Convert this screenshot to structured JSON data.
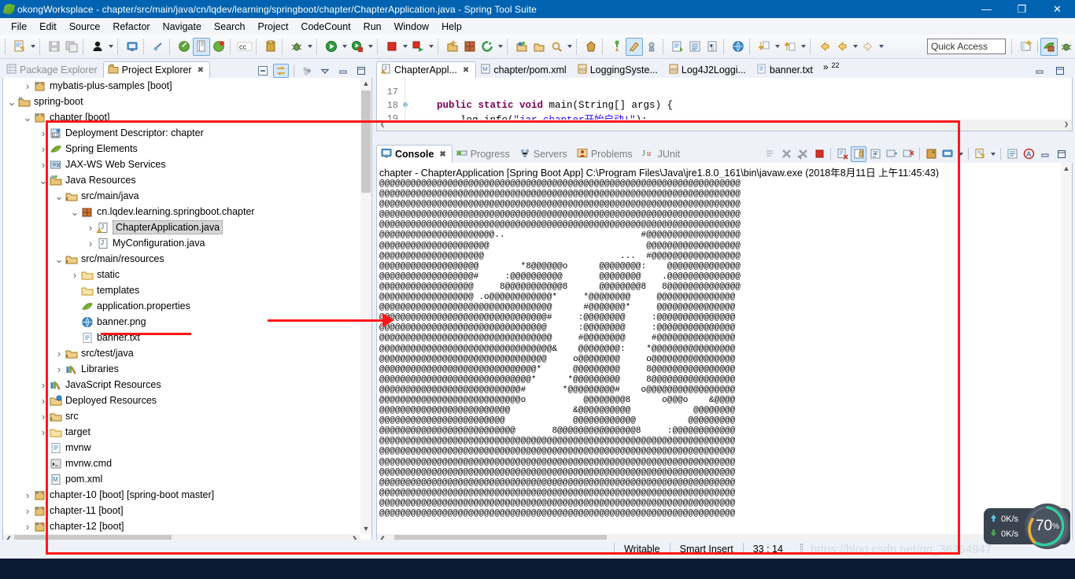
{
  "window": {
    "title": "okongWorksplace - chapter/src/main/java/cn/lqdev/learning/springboot/chapter/ChapterApplication.java - Spring Tool Suite",
    "app_icon": "sts-leaf-icon",
    "minimize": "—",
    "restore": "❐",
    "close": "✕"
  },
  "menu": {
    "items": [
      {
        "label": "File",
        "mnemonic": "F"
      },
      {
        "label": "Edit",
        "mnemonic": "E"
      },
      {
        "label": "Source",
        "mnemonic": "S"
      },
      {
        "label": "Refactor",
        "mnemonic": "t"
      },
      {
        "label": "Navigate",
        "mnemonic": "N"
      },
      {
        "label": "Search",
        "mnemonic": "a"
      },
      {
        "label": "Project",
        "mnemonic": "P"
      },
      {
        "label": "CodeCount",
        "mnemonic": "C"
      },
      {
        "label": "Run",
        "mnemonic": "R"
      },
      {
        "label": "Window",
        "mnemonic": "W"
      },
      {
        "label": "Help",
        "mnemonic": "H"
      }
    ]
  },
  "toolbar": {
    "quick_access_placeholder": "Quick Access",
    "buttons": [
      "new-wizard-icon",
      "save-icon",
      "save-all-icon",
      "user-icon",
      "console-view-icon",
      "disable-breakpoint-icon",
      "spring-boot-dashboard-icon",
      "boot-wizard-icon",
      "spring-icon",
      "codecount-icon",
      "copy-icon",
      "debug-icon",
      "run-icon",
      "run-boot-icon",
      "terminate-icon",
      "relaunch-icon",
      "new-java-project-icon",
      "new-package-icon",
      "refresh-icon",
      "open-type-icon",
      "open-resource-icon",
      "search-icon",
      "bucket-icon",
      "pin-icon",
      "toggle-mark-occurrences-icon",
      "annotation-icon",
      "open-task-icon",
      "outline-icon",
      "paragraph-icon",
      "web-browser-icon",
      "next-annotation-icon",
      "prev-annotation-icon",
      "back-icon",
      "forward-back-icon",
      "forward-icon"
    ],
    "right_buttons": [
      "open-perspective-icon",
      "spring-perspective-icon",
      "debug-perspective-icon"
    ]
  },
  "explorer": {
    "tabs": [
      {
        "label": "Package Explorer",
        "icon": "package-explorer-icon",
        "active": false,
        "closeable": false
      },
      {
        "label": "Project Explorer",
        "icon": "project-explorer-icon",
        "active": true,
        "closeable": true
      }
    ],
    "view_tools": [
      "collapse-all-icon",
      "link-with-editor-icon",
      "view-menu-icon",
      "minimize-icon",
      "maximize-icon"
    ],
    "tree": [
      {
        "indent": 1,
        "twisty": "collapsed",
        "icon": "maven-project-icon",
        "label": "mybatis-plus-samples",
        "suffix": " [boot]"
      },
      {
        "indent": 0,
        "twisty": "expanded",
        "icon": "project-folder-icon",
        "label": "spring-boot",
        "suffix": ""
      },
      {
        "indent": 1,
        "twisty": "expanded",
        "icon": "maven-project-icon",
        "label": "chapter",
        "suffix": " [boot]"
      },
      {
        "indent": 2,
        "twisty": "collapsed",
        "icon": "deployment-descriptor-icon",
        "label": "Deployment Descriptor: chapter",
        "suffix": ""
      },
      {
        "indent": 2,
        "twisty": "collapsed",
        "icon": "spring-leaf-icon",
        "label": "Spring Elements",
        "suffix": ""
      },
      {
        "indent": 2,
        "twisty": "collapsed",
        "icon": "jaxws-icon",
        "label": "JAX-WS Web Services",
        "suffix": ""
      },
      {
        "indent": 2,
        "twisty": "expanded",
        "icon": "java-resources-icon",
        "label": "Java Resources",
        "suffix": ""
      },
      {
        "indent": 3,
        "twisty": "expanded",
        "icon": "source-folder-icon",
        "label": "src/main/java",
        "suffix": ""
      },
      {
        "indent": 4,
        "twisty": "expanded",
        "icon": "package-icon",
        "label": "cn.lqdev.learning.springboot.chapter",
        "suffix": ""
      },
      {
        "indent": 5,
        "twisty": "collapsed",
        "icon": "java-class-warning-icon",
        "label": "ChapterApplication.java",
        "suffix": "",
        "selected": true
      },
      {
        "indent": 5,
        "twisty": "collapsed",
        "icon": "java-class-icon",
        "label": "MyConfiguration.java",
        "suffix": ""
      },
      {
        "indent": 3,
        "twisty": "expanded",
        "icon": "source-folder-icon",
        "label": "src/main/resources",
        "suffix": ""
      },
      {
        "indent": 4,
        "twisty": "collapsed",
        "icon": "folder-icon",
        "label": "static",
        "suffix": ""
      },
      {
        "indent": 4,
        "twisty": "none",
        "icon": "folder-icon",
        "label": "templates",
        "suffix": ""
      },
      {
        "indent": 4,
        "twisty": "none",
        "icon": "spring-leaf-icon",
        "label": "application.properties",
        "suffix": ""
      },
      {
        "indent": 4,
        "twisty": "none",
        "icon": "image-file-icon",
        "label": "banner.png",
        "suffix": "",
        "underlined": true
      },
      {
        "indent": 4,
        "twisty": "none",
        "icon": "text-file-icon",
        "label": "banner.txt",
        "suffix": ""
      },
      {
        "indent": 3,
        "twisty": "collapsed",
        "icon": "source-folder-icon",
        "label": "src/test/java",
        "suffix": ""
      },
      {
        "indent": 3,
        "twisty": "collapsed",
        "icon": "library-icon",
        "label": "Libraries",
        "suffix": ""
      },
      {
        "indent": 2,
        "twisty": "collapsed",
        "icon": "library-icon",
        "label": "JavaScript Resources",
        "suffix": ""
      },
      {
        "indent": 2,
        "twisty": "collapsed",
        "icon": "deployed-resources-icon",
        "label": "Deployed Resources",
        "suffix": ""
      },
      {
        "indent": 2,
        "twisty": "collapsed",
        "icon": "source-folder-icon",
        "label": "src",
        "suffix": ""
      },
      {
        "indent": 2,
        "twisty": "collapsed",
        "icon": "folder-icon",
        "label": "target",
        "suffix": ""
      },
      {
        "indent": 2,
        "twisty": "none",
        "icon": "text-file-icon",
        "label": "mvnw",
        "suffix": ""
      },
      {
        "indent": 2,
        "twisty": "none",
        "icon": "cmd-file-icon",
        "label": "mvnw.cmd",
        "suffix": ""
      },
      {
        "indent": 2,
        "twisty": "none",
        "icon": "maven-pom-icon",
        "label": "pom.xml",
        "suffix": ""
      },
      {
        "indent": 1,
        "twisty": "collapsed",
        "icon": "maven-project-icon",
        "label": "chapter-10",
        "suffix": " [boot] [spring-boot master]"
      },
      {
        "indent": 1,
        "twisty": "collapsed",
        "icon": "maven-project-icon",
        "label": "chapter-11",
        "suffix": " [boot]"
      },
      {
        "indent": 1,
        "twisty": "collapsed",
        "icon": "maven-project-icon",
        "label": "chapter-12",
        "suffix": " [boot]"
      }
    ]
  },
  "editor": {
    "tabs": [
      {
        "label": "ChapterAppl...",
        "icon": "java-class-warning-icon",
        "active": true,
        "closeable": true
      },
      {
        "label": "chapter/pom.xml",
        "icon": "maven-pom-icon",
        "active": false,
        "closeable": false
      },
      {
        "label": "LoggingSyste...",
        "icon": "properties-file-icon",
        "active": false,
        "closeable": false
      },
      {
        "label": "Log4J2Loggi...",
        "icon": "properties-file-icon",
        "active": false,
        "closeable": false
      },
      {
        "label": "banner.txt",
        "icon": "text-file-icon",
        "active": false,
        "closeable": false
      }
    ],
    "overflow_count": "22",
    "overflow_chevron": "»",
    "lines": [
      {
        "num": "17",
        "fold": "",
        "text": ""
      },
      {
        "num": "18",
        "fold": "⊖",
        "text": "    public static void main(String[] args) {"
      },
      {
        "num": "19",
        "fold": "",
        "text": "        log.info(\"jar chapter开始启动!\");"
      }
    ]
  },
  "console": {
    "tabs": [
      {
        "label": "Console",
        "icon": "console-icon",
        "active": true,
        "closeable": true
      },
      {
        "label": "Progress",
        "icon": "progress-icon",
        "active": false,
        "closeable": false
      },
      {
        "label": "Servers",
        "icon": "servers-icon",
        "active": false,
        "closeable": false
      },
      {
        "label": "Problems",
        "icon": "problems-icon",
        "active": false,
        "closeable": false
      },
      {
        "label": "JUnit",
        "icon": "junit-icon",
        "active": false,
        "closeable": false
      }
    ],
    "tools": [
      "remove-all-terminated-icon",
      "terminate-icon",
      "remove-launch-icon",
      "stop-icon",
      "clear-console-icon",
      "scroll-lock-icon",
      "word-wrap-icon",
      "show-console-on-output-icon",
      "show-console-on-error-icon",
      "pin-console-icon",
      "display-selected-console-icon",
      "open-console-icon",
      "outline-icon",
      "error-log-icon",
      "minimize-icon",
      "maximize-icon"
    ],
    "header": "chapter - ChapterApplication [Spring Boot App] C:\\Program Files\\Java\\jre1.8.0_161\\bin\\javaw.exe (2018年8月11日 上午11:45:43)",
    "ascii_lines": [
      "@@@@@@@@@@@@@@@@@@@@@@@@@@@@@@@@@@@@@@@@@@@@@@@@@@@@@@@@@@@@@@@@@@@@@",
      "@@@@@@@@@@@@@@@@@@@@@@@@@@@@@@@@@@@@@@@@@@@@@@@@@@@@@@@@@@@@@@@@@@@@@",
      "@@@@@@@@@@@@@@@@@@@@@@@@@@@@@@@@@@@@@@@@@@@@@@@@@@@@@@@@@@@@@@@@@@@@@",
      "@@@@@@@@@@@@@@@@@@@@@@@@@@@@@@@@@@@@@@@@@@@@@@@@@@@@@@@@@@@@@@@@@@@@@",
      "@@@@@@@@@@@@@@@@@@@@@@@@@@@@@@@@@@@@@@@@@@@@@@@@@@@@@@@@@@@@@@@@@@@@@",
      "@@@@@@@@@@@@@@@@@@@@@@..                          #@@@@@@@@@@@@@@@@@@",
      "@@@@@@@@@@@@@@@@@@@@@                              @@@@@@@@@@@@@@@@@@",
      "@@@@@@@@@@@@@@@@@@@@                          ...  #@@@@@@@@@@@@@@@@@",
      "@@@@@@@@@@@@@@@@@@@        *8@@@@@@o      @@@@@@@@:    @@@@@@@@@@@@@@",
      "@@@@@@@@@@@@@@@@@@#     :@@@@@@@@@@       @@@@@@@@    .@@@@@@@@@@@@@@",
      "@@@@@@@@@@@@@@@@@@     8@@@@@@@@@@@8      @@@@@@@@8   8@@@@@@@@@@@@@@",
      "@@@@@@@@@@@@@@@@@@ .o@@@@@@@@@@@@*     *@@@@@@@@     @@@@@@@@@@@@@@@",
      "@@@@@@@@@@@@@@@@@@@@@@@@@@@@@@@@@      #@@@@@@@*     @@@@@@@@@@@@@@@",
      "@@@@@@@@@@@@@@@@@@@@@@@@@@@@@@@@#     :@@@@@@@@     :@@@@@@@@@@@@@@@",
      "@@@@@@@@@@@@@@@@@@@@@@@@@@@@@@@@      :@@@@@@@@     :@@@@@@@@@@@@@@@",
      "@@@@@@@@@@@@@@@@@@@@@@@@@@@@@@@@@     #@@@@@@@@     #@@@@@@@@@@@@@@@",
      "@@@@@@@@@@@@@@@@@@@@@@@@@@@@@@@@@&    @@@@@@@@:    *@@@@@@@@@@@@@@@@",
      "@@@@@@@@@@@@@@@@@@@@@@@@@@@@@@@@     o@@@@@@@@     o@@@@@@@@@@@@@@@@",
      "@@@@@@@@@@@@@@@@@@@@@@@@@@@@@@*      @@@@@@@@@     8@@@@@@@@@@@@@@@@",
      "@@@@@@@@@@@@@@@@@@@@@@@@@@@@@*      *@@@@@@@@@     8@@@@@@@@@@@@@@@@",
      "@@@@@@@@@@@@@@@@@@@@@@@@@@@#       *@@@@@@@@@#    o@@@@@@@@@@@@@@@@@",
      "@@@@@@@@@@@@@@@@@@@@@@@@@@@o           @@@@@@@@8      o@@@o    &@@@@",
      "@@@@@@@@@@@@@@@@@@@@@@@@@            &@@@@@@@@@@            @@@@@@@@",
      "@@@@@@@@@@@@@@@@@@@@@@@@             @@@@@@@@@@@@          @@@@@@@@@",
      "@@@@@@@@@@@@@@@@@@@@@@@@@@       8@@@@@@@@@@@@@@@8     :@@@@@@@@@@@@",
      "@@@@@@@@@@@@@@@@@@@@@@@@@@@@@@@@@@@@@@@@@@@@@@@@@@@@@@@@@@@@@@@@@@@@",
      "@@@@@@@@@@@@@@@@@@@@@@@@@@@@@@@@@@@@@@@@@@@@@@@@@@@@@@@@@@@@@@@@@@@@",
      "@@@@@@@@@@@@@@@@@@@@@@@@@@@@@@@@@@@@@@@@@@@@@@@@@@@@@@@@@@@@@@@@@@@@",
      "@@@@@@@@@@@@@@@@@@@@@@@@@@@@@@@@@@@@@@@@@@@@@@@@@@@@@@@@@@@@@@@@@@@@",
      "@@@@@@@@@@@@@@@@@@@@@@@@@@@@@@@@@@@@@@@@@@@@@@@@@@@@@@@@@@@@@@@@@@@@",
      "@@@@@@@@@@@@@@@@@@@@@@@@@@@@@@@@@@@@@@@@@@@@@@@@@@@@@@@@@@@@@@@@@@@@",
      "@@@@@@@@@@@@@@@@@@@@@@@@@@@@@@@@@@@@@@@@@@@@@@@@@@@@@@@@@@@@@@@@@@@@",
      "@@@@@@@@@@@@@@@@@@@@@@@@@@@@@@@@@@@@@@@@@@@@@@@@@@@@@@@@@@@@@@@@@@@@"
    ]
  },
  "statusbar": {
    "writable": "Writable",
    "insert_mode": "Smart Insert",
    "position": "33 : 14",
    "watermark": "https://blog.csdn.net/qq_36254947"
  },
  "net_widget": {
    "up_icon": "arrow-up-icon",
    "up_value": "0K/s",
    "down_icon": "arrow-down-icon",
    "down_value": "0K/s",
    "percent": "70",
    "percent_unit": "%"
  },
  "colors": {
    "title_bar": "#0063b1",
    "accent_red": "#ff1818",
    "tab_active": "#ffffff",
    "panel_bg": "#eef1f7",
    "selection": "#d6d6d6"
  }
}
